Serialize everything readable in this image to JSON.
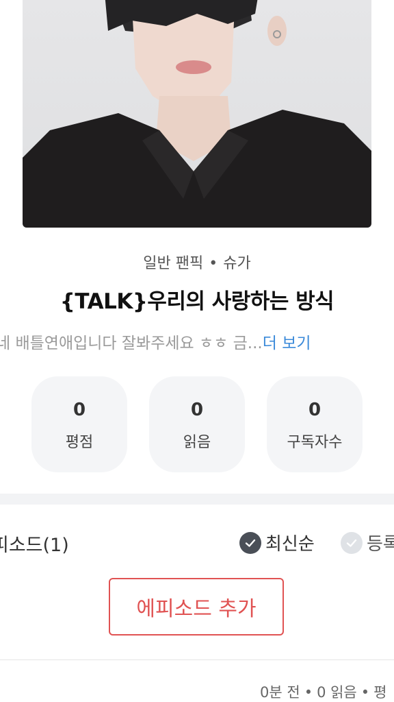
{
  "work": {
    "genre": "일반 팬픽",
    "character": "슈가",
    "separator": "•",
    "title": "{TALK}우리의 사랑하는 방식",
    "description": "네 배틀연애입니다 잘봐주세요 ㅎㅎ 금...",
    "more_label": "더 보기"
  },
  "stats": [
    {
      "value": "0",
      "label": "평점"
    },
    {
      "value": "0",
      "label": "읽음"
    },
    {
      "value": "0",
      "label": "구독자수"
    }
  ],
  "episodes": {
    "count_label": "피소드(1)",
    "sort_latest": "최신순",
    "sort_registered": "등록",
    "add_button": "에피소드 추가",
    "item_meta": {
      "time": "0분 전",
      "reads": "0 읽음",
      "rating": "평"
    }
  },
  "colors": {
    "accent_red": "#e05252",
    "link_blue": "#3b8ad9"
  }
}
